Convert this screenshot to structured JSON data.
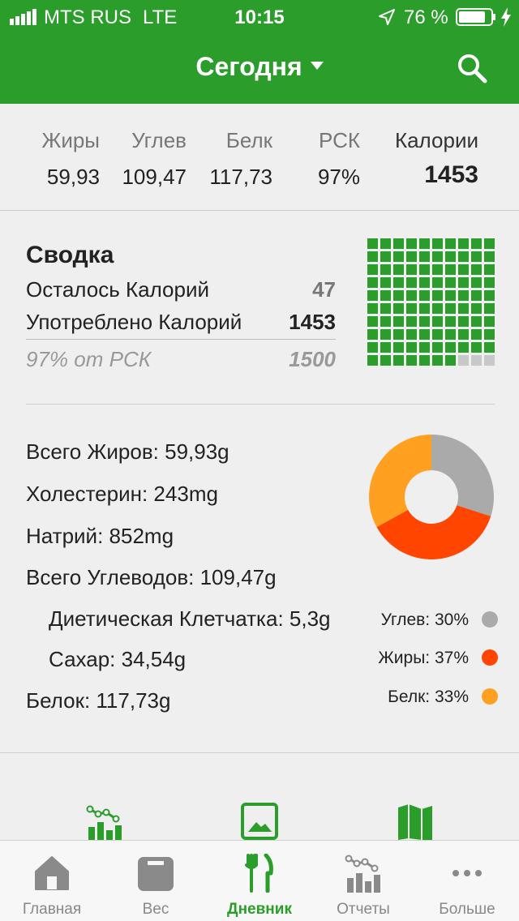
{
  "status": {
    "carrier": "MTS RUS",
    "network": "LTE",
    "time": "10:15",
    "battery": "76 %"
  },
  "header": {
    "title": "Сегодня"
  },
  "macros": [
    {
      "label": "Жиры",
      "value": "59,93"
    },
    {
      "label": "Углев",
      "value": "109,47"
    },
    {
      "label": "Белк",
      "value": "117,73"
    },
    {
      "label": "РСК",
      "value": "97%"
    },
    {
      "label": "Калории",
      "value": "1453"
    }
  ],
  "summary": {
    "title": "Сводка",
    "remaining_label": "Осталось Калорий",
    "remaining_value": "47",
    "consumed_label": "Употреблено Калорий",
    "consumed_value": "1453",
    "pct_label": "97% от РСК",
    "pct_value": "1500",
    "grid_filled_fraction": 0.97
  },
  "nutrients": {
    "total_fat": "Всего Жиров: 59,93g",
    "cholesterol": "Холестерин: 243mg",
    "sodium": "Натрий: 852mg",
    "total_carbs": "Всего Углеводов: 109,47g",
    "fiber": "Диетическая Клетчатка: 5,3g",
    "sugar": "Сахар: 34,54g",
    "protein": "Белок: 117,73g"
  },
  "pie": [
    {
      "label": "Углев: 30%",
      "percent": 30,
      "color": "#aaaaaa"
    },
    {
      "label": "Жиры: 37%",
      "percent": 37,
      "color": "#ff4500"
    },
    {
      "label": "Белк: 33%",
      "percent": 33,
      "color": "#ffa020"
    }
  ],
  "colors": {
    "accent": "#2a9d2b",
    "grid_empty": "#c8c8c8"
  },
  "tabs": [
    {
      "label": "Главная",
      "icon": "home-icon"
    },
    {
      "label": "Вес",
      "icon": "scale-icon"
    },
    {
      "label": "Дневник",
      "icon": "fork-knife-icon",
      "active": true
    },
    {
      "label": "Отчеты",
      "icon": "reports-icon"
    },
    {
      "label": "Больше",
      "icon": "more-icon"
    }
  ]
}
